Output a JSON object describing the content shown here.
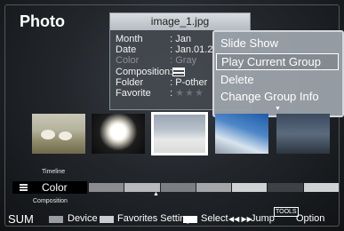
{
  "page": {
    "title": "Photo"
  },
  "info_panel": {
    "filename": "image_1.jpg",
    "rows": [
      {
        "key": "Month",
        "value": ": Jan",
        "dim": false
      },
      {
        "key": "Date",
        "value": ": Jan.01.2",
        "dim": false
      },
      {
        "key": "Color",
        "value": ": Gray",
        "dim": true
      },
      {
        "key": "Composition",
        "value": ":",
        "dim": false
      },
      {
        "key": "Folder",
        "value": ": P-other",
        "dim": false
      },
      {
        "key": "Favorite",
        "value": ":",
        "dim": false
      }
    ],
    "favorite_stars": "★★★"
  },
  "menu": {
    "items": [
      "Slide Show",
      "Play Current Group",
      "Delete",
      "Change Group Info"
    ],
    "selected_index": 1
  },
  "thumbnails": [
    {
      "name": "thumbnail-sheep",
      "selected": false
    },
    {
      "name": "thumbnail-flower",
      "selected": false
    },
    {
      "name": "thumbnail-sky",
      "selected": true
    },
    {
      "name": "thumbnail-mountain",
      "selected": false
    },
    {
      "name": "thumbnail-dark",
      "selected": false
    }
  ],
  "sort": {
    "timeline_label": "Timeline",
    "current_label": "Color",
    "composition_label": "Composition"
  },
  "color_bar": [
    "#8a8c8f",
    "#b7b9bc",
    "#7b7e82",
    "#a4a6a9",
    "#d0d2d4",
    "#3e4145",
    "#cfd1d3"
  ],
  "footer": {
    "sum": "SUM",
    "device": "Device",
    "favorites": "Favorites Setting",
    "select": "Select",
    "jump_arrows": "◀◀ ▶▶",
    "jump": "Jump",
    "tools": "TOOLS",
    "option": "Option"
  },
  "colors": {
    "accent": "#ffffff",
    "menu_bg": "#9ca2aa",
    "background": "#23272c"
  }
}
